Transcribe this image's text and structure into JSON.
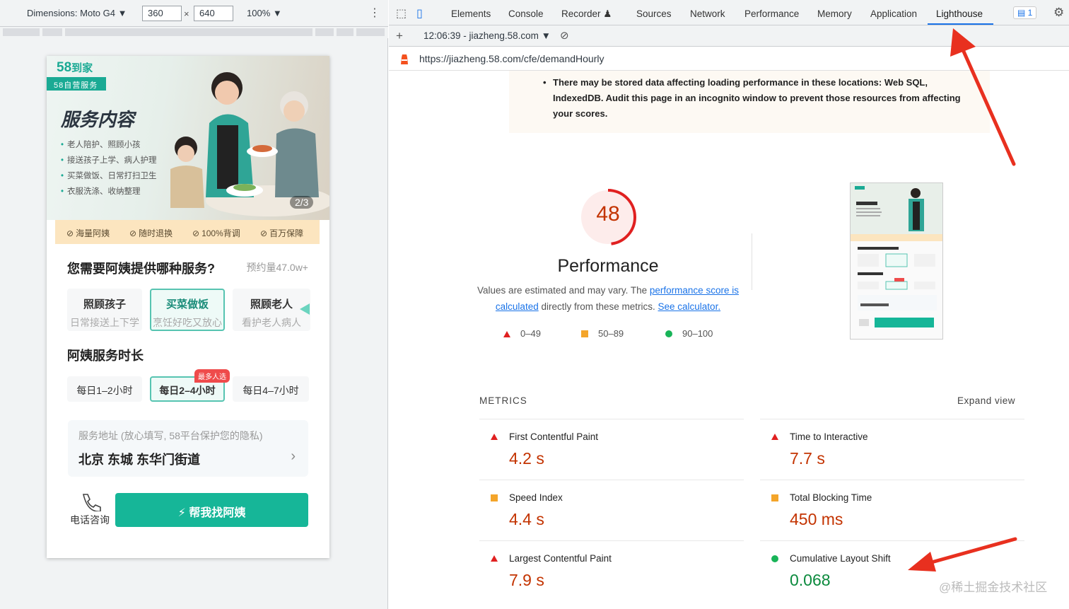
{
  "device_toolbar": {
    "dimensions_label": "Dimensions: Moto G4 ▼",
    "width": "360",
    "times": "×",
    "height": "640",
    "zoom": "100% ▼",
    "more": "⋮"
  },
  "phone": {
    "logo": "58",
    "logo_suffix": "到家",
    "logo_tag": "58自营服务",
    "hero_title": "服务内容",
    "bullets": [
      "老人陪护、照顾小孩",
      "接送孩子上学、病人护理",
      "买菜做饭、日常打扫卫生",
      "衣服洗涤、收纳整理"
    ],
    "pager": "2/3",
    "guarantees": [
      "海量阿姨",
      "随时退换",
      "100%背调",
      "百万保障"
    ],
    "service_question": "您需要阿姨提供哪种服务?",
    "service_estimate": "预约量47.0w+",
    "services": [
      {
        "title": "照顾孩子",
        "sub": "日常接送上下学"
      },
      {
        "title": "买菜做饭",
        "sub": "烹饪好吃又放心"
      },
      {
        "title": "照顾老人",
        "sub": "看护老人病人"
      }
    ],
    "duration_title": "阿姨服务时长",
    "durations": [
      "每日1–2小时",
      "每日2–4小时",
      "每日4–7小时"
    ],
    "hot_badge": "最多人选",
    "address_hint": "服务地址 (放心填写, 58平台保护您的隐私)",
    "address_value": "北京 东城 东华门街道",
    "address_arrow": "›",
    "call_label": "电话咨询",
    "find_button": "帮我找阿姨"
  },
  "devtools": {
    "tabs": [
      "Elements",
      "Console",
      "Recorder ♟",
      "Sources",
      "Network",
      "Performance",
      "Memory",
      "Application",
      "Lighthouse"
    ],
    "active_tab": "Lighthouse",
    "issues_badge": "1",
    "report_time": "12:06:39 - jiazheng.58.com ▼",
    "url": "https://jiazheng.58.com/cfe/demandHourly"
  },
  "lighthouse": {
    "warning": "There may be stored data affecting loading performance in these locations: Web SQL, IndexedDB. Audit this page in an incognito window to prevent those resources from affecting your scores.",
    "score": "48",
    "score_value": 48,
    "category": "Performance",
    "desc_1": "Values are estimated and may vary. The ",
    "desc_link_1": "performance score is calculated",
    "desc_2": " directly from these metrics. ",
    "desc_link_2": "See calculator.",
    "legend": [
      "0–49",
      "50–89",
      "90–100"
    ],
    "metrics_label": "METRICS",
    "expand_view": "Expand view",
    "metrics": [
      {
        "label": "First Contentful Paint",
        "value": "4.2 s",
        "status": "fail"
      },
      {
        "label": "Time to Interactive",
        "value": "7.7 s",
        "status": "fail"
      },
      {
        "label": "Speed Index",
        "value": "4.4 s",
        "status": "average"
      },
      {
        "label": "Total Blocking Time",
        "value": "450 ms",
        "status": "average"
      },
      {
        "label": "Largest Contentful Paint",
        "value": "7.9 s",
        "status": "fail"
      },
      {
        "label": "Cumulative Layout Shift",
        "value": "0.068",
        "status": "pass"
      }
    ],
    "colors": {
      "fail": "#e02020",
      "average": "#f4a52a",
      "pass": "#18b458",
      "score": "#c33300",
      "arrow": "#e8301f"
    }
  },
  "watermark": "@稀土掘金技术社区"
}
